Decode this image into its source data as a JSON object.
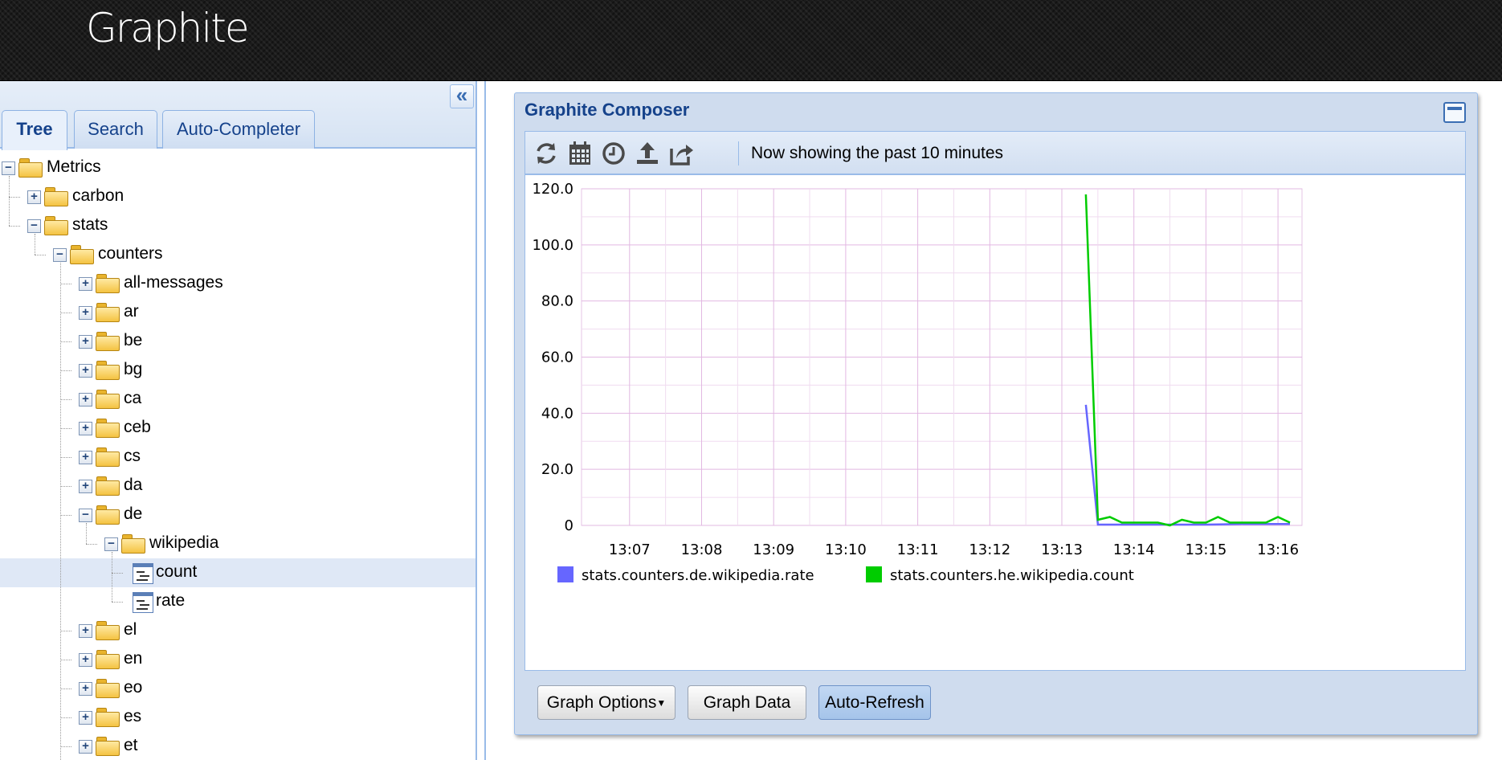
{
  "app": {
    "title": "Graphite"
  },
  "tabs": [
    "Tree",
    "Search",
    "Auto-Completer"
  ],
  "tree": [
    {
      "label": "Metrics",
      "level": 0,
      "type": "folder",
      "expanded": true
    },
    {
      "label": "carbon",
      "level": 1,
      "type": "folder",
      "expanded": false
    },
    {
      "label": "stats",
      "level": 1,
      "type": "folder",
      "expanded": true
    },
    {
      "label": "counters",
      "level": 2,
      "type": "folder",
      "expanded": true
    },
    {
      "label": "all-messages",
      "level": 3,
      "type": "folder",
      "expanded": false
    },
    {
      "label": "ar",
      "level": 3,
      "type": "folder",
      "expanded": false
    },
    {
      "label": "be",
      "level": 3,
      "type": "folder",
      "expanded": false
    },
    {
      "label": "bg",
      "level": 3,
      "type": "folder",
      "expanded": false
    },
    {
      "label": "ca",
      "level": 3,
      "type": "folder",
      "expanded": false
    },
    {
      "label": "ceb",
      "level": 3,
      "type": "folder",
      "expanded": false
    },
    {
      "label": "cs",
      "level": 3,
      "type": "folder",
      "expanded": false
    },
    {
      "label": "da",
      "level": 3,
      "type": "folder",
      "expanded": false
    },
    {
      "label": "de",
      "level": 3,
      "type": "folder",
      "expanded": true
    },
    {
      "label": "wikipedia",
      "level": 4,
      "type": "folder",
      "expanded": true
    },
    {
      "label": "count",
      "level": 5,
      "type": "leaf",
      "selected": true
    },
    {
      "label": "rate",
      "level": 5,
      "type": "leaf"
    },
    {
      "label": "el",
      "level": 3,
      "type": "folder",
      "expanded": false
    },
    {
      "label": "en",
      "level": 3,
      "type": "folder",
      "expanded": false
    },
    {
      "label": "eo",
      "level": 3,
      "type": "folder",
      "expanded": false
    },
    {
      "label": "es",
      "level": 3,
      "type": "folder",
      "expanded": false
    },
    {
      "label": "et",
      "level": 3,
      "type": "folder",
      "expanded": false
    }
  ],
  "composer": {
    "title": "Graphite Composer",
    "toolbar_icons": [
      "refresh-icon",
      "calendar-icon",
      "clock-icon",
      "upload-icon",
      "share-icon"
    ],
    "status_text": "Now showing the past 10 minutes",
    "buttons": {
      "graph_options": "Graph Options",
      "graph_data": "Graph Data",
      "auto_refresh": "Auto-Refresh"
    }
  },
  "colors": {
    "header_bg": "#1b1b1b",
    "accent_blue": "#15428b",
    "panel_border": "#99bbe8",
    "grid_color": "#e6c4e6"
  },
  "chart_data": {
    "type": "line",
    "ylim": [
      0,
      120
    ],
    "yticks": [
      "120.0",
      "100.0",
      "80.0",
      "60.0",
      "40.0",
      "20.0",
      "0"
    ],
    "yticks_values": [
      120,
      100,
      80,
      60,
      40,
      20,
      0
    ],
    "xticks": [
      "13:07",
      "13:08",
      "13:09",
      "13:10",
      "13:11",
      "13:12",
      "13:13",
      "13:14",
      "13:15",
      "13:16"
    ],
    "xlim_minutes": [
      13.0,
      13.0
    ],
    "grid": true,
    "legend_placement": "bottom-left",
    "series": [
      {
        "name": "stats.counters.de.wikipedia.rate",
        "color": "#6666ff",
        "points": [
          [
            "13:13:20",
            43
          ],
          [
            "13:13:30",
            0.3
          ],
          [
            "13:14:00",
            0.3
          ],
          [
            "13:14:30",
            0.3
          ],
          [
            "13:15:00",
            0.3
          ],
          [
            "13:15:30",
            0.5
          ],
          [
            "13:16:00",
            0.5
          ],
          [
            "13:16:10",
            0.5
          ]
        ]
      },
      {
        "name": "stats.counters.he.wikipedia.count",
        "color": "#00cc00",
        "points": [
          [
            "13:13:20",
            118
          ],
          [
            "13:13:30",
            2
          ],
          [
            "13:13:40",
            3
          ],
          [
            "13:13:50",
            1
          ],
          [
            "13:14:00",
            1
          ],
          [
            "13:14:10",
            1
          ],
          [
            "13:14:20",
            1
          ],
          [
            "13:14:30",
            0
          ],
          [
            "13:14:40",
            2
          ],
          [
            "13:14:50",
            1
          ],
          [
            "13:15:00",
            1
          ],
          [
            "13:15:10",
            3
          ],
          [
            "13:15:20",
            1
          ],
          [
            "13:15:30",
            1
          ],
          [
            "13:15:40",
            1
          ],
          [
            "13:15:50",
            1
          ],
          [
            "13:16:00",
            3
          ],
          [
            "13:16:10",
            1
          ]
        ]
      }
    ]
  }
}
